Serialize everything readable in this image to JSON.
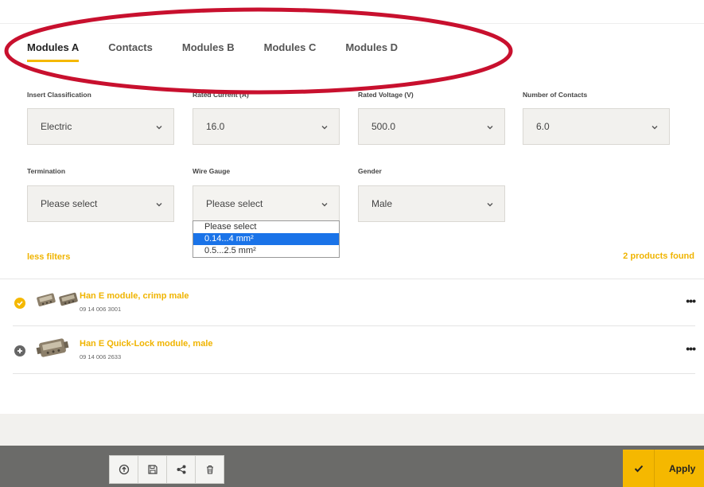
{
  "tabs": [
    {
      "label": "Modules A",
      "active": true
    },
    {
      "label": "Contacts",
      "active": false
    },
    {
      "label": "Modules B",
      "active": false
    },
    {
      "label": "Modules C",
      "active": false
    },
    {
      "label": "Modules D",
      "active": false
    }
  ],
  "filters": {
    "insert_classification": {
      "label": "Insert Classification",
      "value": "Electric"
    },
    "rated_current": {
      "label": "Rated Current (A)",
      "value": "16.0"
    },
    "rated_voltage": {
      "label": "Rated Voltage (V)",
      "value": "500.0"
    },
    "number_of_contacts": {
      "label": "Number of Contacts",
      "value": "6.0"
    },
    "termination": {
      "label": "Termination",
      "value": "Please select"
    },
    "wire_gauge": {
      "label": "Wire Gauge",
      "value": "Please select",
      "options": [
        "Please select",
        "0.14...4 mm²",
        "0.5...2.5 mm²"
      ],
      "highlighted_option": "0.14...4 mm²"
    },
    "gender": {
      "label": "Gender",
      "value": "Male"
    }
  },
  "less_filters_label": "less filters",
  "products_found": "2 products found",
  "products": [
    {
      "name": "Han E module, crimp male",
      "number": "09 14 006 3001",
      "selected": true
    },
    {
      "name": "Han E Quick-Lock module, male",
      "number": "09 14 006 2633",
      "selected": false
    }
  ],
  "more_label": "•••",
  "toolbar": {
    "icons": [
      "upload-icon",
      "save-icon",
      "share-icon",
      "trash-icon"
    ],
    "apply_label": "Apply"
  },
  "colors": {
    "accent": "#f5b800",
    "annotation": "#c8102e",
    "dropdown_highlight": "#1a73e8",
    "bottom_bar": "#6b6b69"
  }
}
